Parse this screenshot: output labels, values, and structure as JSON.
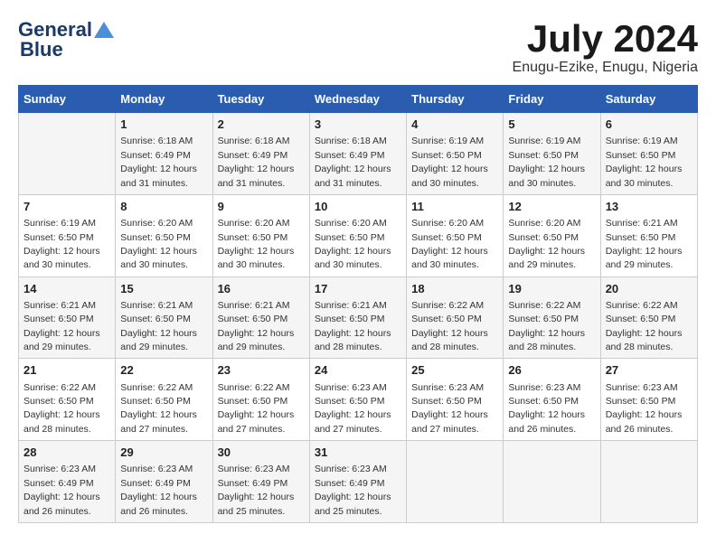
{
  "header": {
    "logo_line1": "General",
    "logo_line2": "Blue",
    "month_year": "July 2024",
    "location": "Enugu-Ezike, Enugu, Nigeria"
  },
  "days_of_week": [
    "Sunday",
    "Monday",
    "Tuesday",
    "Wednesday",
    "Thursday",
    "Friday",
    "Saturday"
  ],
  "weeks": [
    [
      {
        "day": "",
        "info": ""
      },
      {
        "day": "1",
        "info": "Sunrise: 6:18 AM\nSunset: 6:49 PM\nDaylight: 12 hours\nand 31 minutes."
      },
      {
        "day": "2",
        "info": "Sunrise: 6:18 AM\nSunset: 6:49 PM\nDaylight: 12 hours\nand 31 minutes."
      },
      {
        "day": "3",
        "info": "Sunrise: 6:18 AM\nSunset: 6:49 PM\nDaylight: 12 hours\nand 31 minutes."
      },
      {
        "day": "4",
        "info": "Sunrise: 6:19 AM\nSunset: 6:50 PM\nDaylight: 12 hours\nand 30 minutes."
      },
      {
        "day": "5",
        "info": "Sunrise: 6:19 AM\nSunset: 6:50 PM\nDaylight: 12 hours\nand 30 minutes."
      },
      {
        "day": "6",
        "info": "Sunrise: 6:19 AM\nSunset: 6:50 PM\nDaylight: 12 hours\nand 30 minutes."
      }
    ],
    [
      {
        "day": "7",
        "info": "Sunrise: 6:19 AM\nSunset: 6:50 PM\nDaylight: 12 hours\nand 30 minutes."
      },
      {
        "day": "8",
        "info": "Sunrise: 6:20 AM\nSunset: 6:50 PM\nDaylight: 12 hours\nand 30 minutes."
      },
      {
        "day": "9",
        "info": "Sunrise: 6:20 AM\nSunset: 6:50 PM\nDaylight: 12 hours\nand 30 minutes."
      },
      {
        "day": "10",
        "info": "Sunrise: 6:20 AM\nSunset: 6:50 PM\nDaylight: 12 hours\nand 30 minutes."
      },
      {
        "day": "11",
        "info": "Sunrise: 6:20 AM\nSunset: 6:50 PM\nDaylight: 12 hours\nand 30 minutes."
      },
      {
        "day": "12",
        "info": "Sunrise: 6:20 AM\nSunset: 6:50 PM\nDaylight: 12 hours\nand 29 minutes."
      },
      {
        "day": "13",
        "info": "Sunrise: 6:21 AM\nSunset: 6:50 PM\nDaylight: 12 hours\nand 29 minutes."
      }
    ],
    [
      {
        "day": "14",
        "info": "Sunrise: 6:21 AM\nSunset: 6:50 PM\nDaylight: 12 hours\nand 29 minutes."
      },
      {
        "day": "15",
        "info": "Sunrise: 6:21 AM\nSunset: 6:50 PM\nDaylight: 12 hours\nand 29 minutes."
      },
      {
        "day": "16",
        "info": "Sunrise: 6:21 AM\nSunset: 6:50 PM\nDaylight: 12 hours\nand 29 minutes."
      },
      {
        "day": "17",
        "info": "Sunrise: 6:21 AM\nSunset: 6:50 PM\nDaylight: 12 hours\nand 28 minutes."
      },
      {
        "day": "18",
        "info": "Sunrise: 6:22 AM\nSunset: 6:50 PM\nDaylight: 12 hours\nand 28 minutes."
      },
      {
        "day": "19",
        "info": "Sunrise: 6:22 AM\nSunset: 6:50 PM\nDaylight: 12 hours\nand 28 minutes."
      },
      {
        "day": "20",
        "info": "Sunrise: 6:22 AM\nSunset: 6:50 PM\nDaylight: 12 hours\nand 28 minutes."
      }
    ],
    [
      {
        "day": "21",
        "info": "Sunrise: 6:22 AM\nSunset: 6:50 PM\nDaylight: 12 hours\nand 28 minutes."
      },
      {
        "day": "22",
        "info": "Sunrise: 6:22 AM\nSunset: 6:50 PM\nDaylight: 12 hours\nand 27 minutes."
      },
      {
        "day": "23",
        "info": "Sunrise: 6:22 AM\nSunset: 6:50 PM\nDaylight: 12 hours\nand 27 minutes."
      },
      {
        "day": "24",
        "info": "Sunrise: 6:23 AM\nSunset: 6:50 PM\nDaylight: 12 hours\nand 27 minutes."
      },
      {
        "day": "25",
        "info": "Sunrise: 6:23 AM\nSunset: 6:50 PM\nDaylight: 12 hours\nand 27 minutes."
      },
      {
        "day": "26",
        "info": "Sunrise: 6:23 AM\nSunset: 6:50 PM\nDaylight: 12 hours\nand 26 minutes."
      },
      {
        "day": "27",
        "info": "Sunrise: 6:23 AM\nSunset: 6:50 PM\nDaylight: 12 hours\nand 26 minutes."
      }
    ],
    [
      {
        "day": "28",
        "info": "Sunrise: 6:23 AM\nSunset: 6:49 PM\nDaylight: 12 hours\nand 26 minutes."
      },
      {
        "day": "29",
        "info": "Sunrise: 6:23 AM\nSunset: 6:49 PM\nDaylight: 12 hours\nand 26 minutes."
      },
      {
        "day": "30",
        "info": "Sunrise: 6:23 AM\nSunset: 6:49 PM\nDaylight: 12 hours\nand 25 minutes."
      },
      {
        "day": "31",
        "info": "Sunrise: 6:23 AM\nSunset: 6:49 PM\nDaylight: 12 hours\nand 25 minutes."
      },
      {
        "day": "",
        "info": ""
      },
      {
        "day": "",
        "info": ""
      },
      {
        "day": "",
        "info": ""
      }
    ]
  ]
}
